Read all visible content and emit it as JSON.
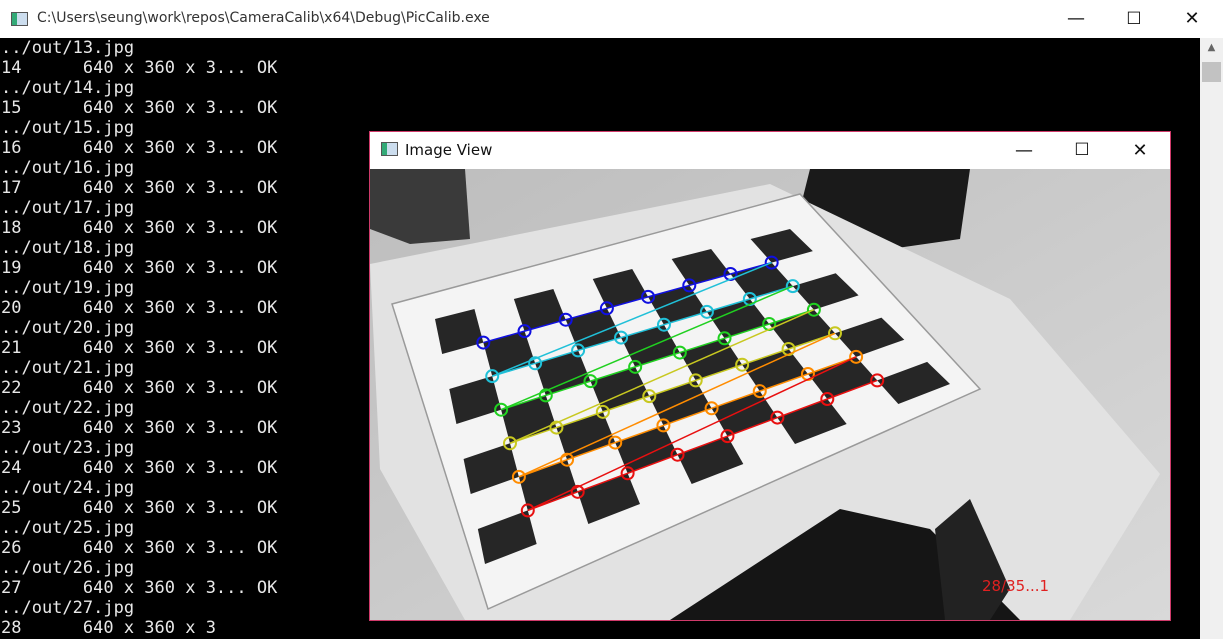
{
  "console": {
    "title": "C:\\Users\\seung\\work\\repos\\CameraCalib\\x64\\Debug\\PicCalib.exe",
    "minimize_glyph": "—",
    "maximize_glyph": "☐",
    "close_glyph": "✕",
    "lines": [
      "../out/13.jpg",
      "14      640 x 360 x 3... OK",
      "../out/14.jpg",
      "15      640 x 360 x 3... OK",
      "../out/15.jpg",
      "16      640 x 360 x 3... OK",
      "../out/16.jpg",
      "17      640 x 360 x 3... OK",
      "../out/17.jpg",
      "18      640 x 360 x 3... OK",
      "../out/18.jpg",
      "19      640 x 360 x 3... OK",
      "../out/19.jpg",
      "20      640 x 360 x 3... OK",
      "../out/20.jpg",
      "21      640 x 360 x 3... OK",
      "../out/21.jpg",
      "22      640 x 360 x 3... OK",
      "../out/22.jpg",
      "23      640 x 360 x 3... OK",
      "../out/23.jpg",
      "24      640 x 360 x 3... OK",
      "../out/24.jpg",
      "25      640 x 360 x 3... OK",
      "../out/25.jpg",
      "26      640 x 360 x 3... OK",
      "../out/26.jpg",
      "27      640 x 360 x 3... OK",
      "../out/27.jpg",
      "28      640 x 360 x 3"
    ]
  },
  "image_view": {
    "title": "Image View",
    "minimize_glyph": "—",
    "maximize_glyph": "☐",
    "close_glyph": "✕",
    "overlay_text": "28/35...1",
    "overlay_color": "#e02020"
  },
  "colors": {
    "corner_rows": [
      "#1010e0",
      "#20c0d8",
      "#20d020",
      "#c8c820",
      "#ff8c00",
      "#e81010"
    ]
  }
}
